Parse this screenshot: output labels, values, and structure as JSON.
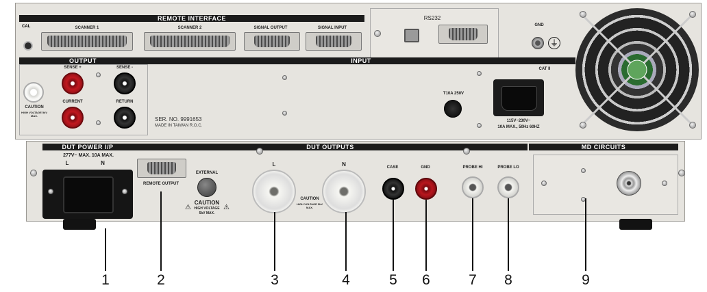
{
  "top_panel": {
    "remote_interface_title": "REMOTE INTERFACE",
    "cal_label": "CAL",
    "scanner1_label": "SCANNER 1",
    "scanner2_label": "SCANNER 2",
    "signal_output_label": "SIGNAL OUTPUT",
    "signal_input_label": "SIGNAL INPUT",
    "rs232_label": "RS232",
    "gnd_label": "GND",
    "output_title": "OUTPUT",
    "sense_plus_label": "SENSE +",
    "sense_minus_label": "SENSE -",
    "current_label": "CURRENT",
    "return_label": "RETURN",
    "caution_label": "CAUTION",
    "caution_small": "HIGH VOLTAGE 5kV MAX.",
    "input_title": "INPUT",
    "cat_label": "CAT II",
    "serial_number": "SER. NO. 9991653",
    "made_in": "MADE IN TAIWAN R.O.C.",
    "fuse_label": "T10A 250V",
    "power_rating_1": "115V~230V~",
    "power_rating_2": "10A MAX., 50Hz 60HZ"
  },
  "bottom_panel": {
    "dut_power_title": "DUT POWER I/P",
    "dut_power_rating": "277V~ MAX. 10A MAX.",
    "dut_power_l": "L",
    "dut_power_n": "N",
    "remote_output_label": "REMOTE OUTPUT",
    "external_label": "EXTERNAL",
    "caution_label": "CAUTION",
    "caution_sub": "HIGH VOLTAGE",
    "caution_max": "5kV MAX.",
    "dut_outputs_title": "DUT OUTPUTS",
    "l_label": "L",
    "n_label": "N",
    "center_caution": "CAUTION",
    "center_caution_sub": "HIGH VOLTAGE 5kV MAX.",
    "case_label": "CASE",
    "gnd_label": "GND",
    "probe_hi_label": "PROBE HI",
    "probe_lo_label": "PROBE LO",
    "md_circuits_title": "MD CIRCUITS"
  },
  "callouts": [
    "1",
    "2",
    "3",
    "4",
    "5",
    "6",
    "7",
    "8",
    "9"
  ],
  "colors": {
    "panel": "#e3e1dc",
    "header_bar": "#1b1b1b",
    "red_post": "#b0141e",
    "black_post": "#151515",
    "white_post": "#f4f4f0"
  }
}
